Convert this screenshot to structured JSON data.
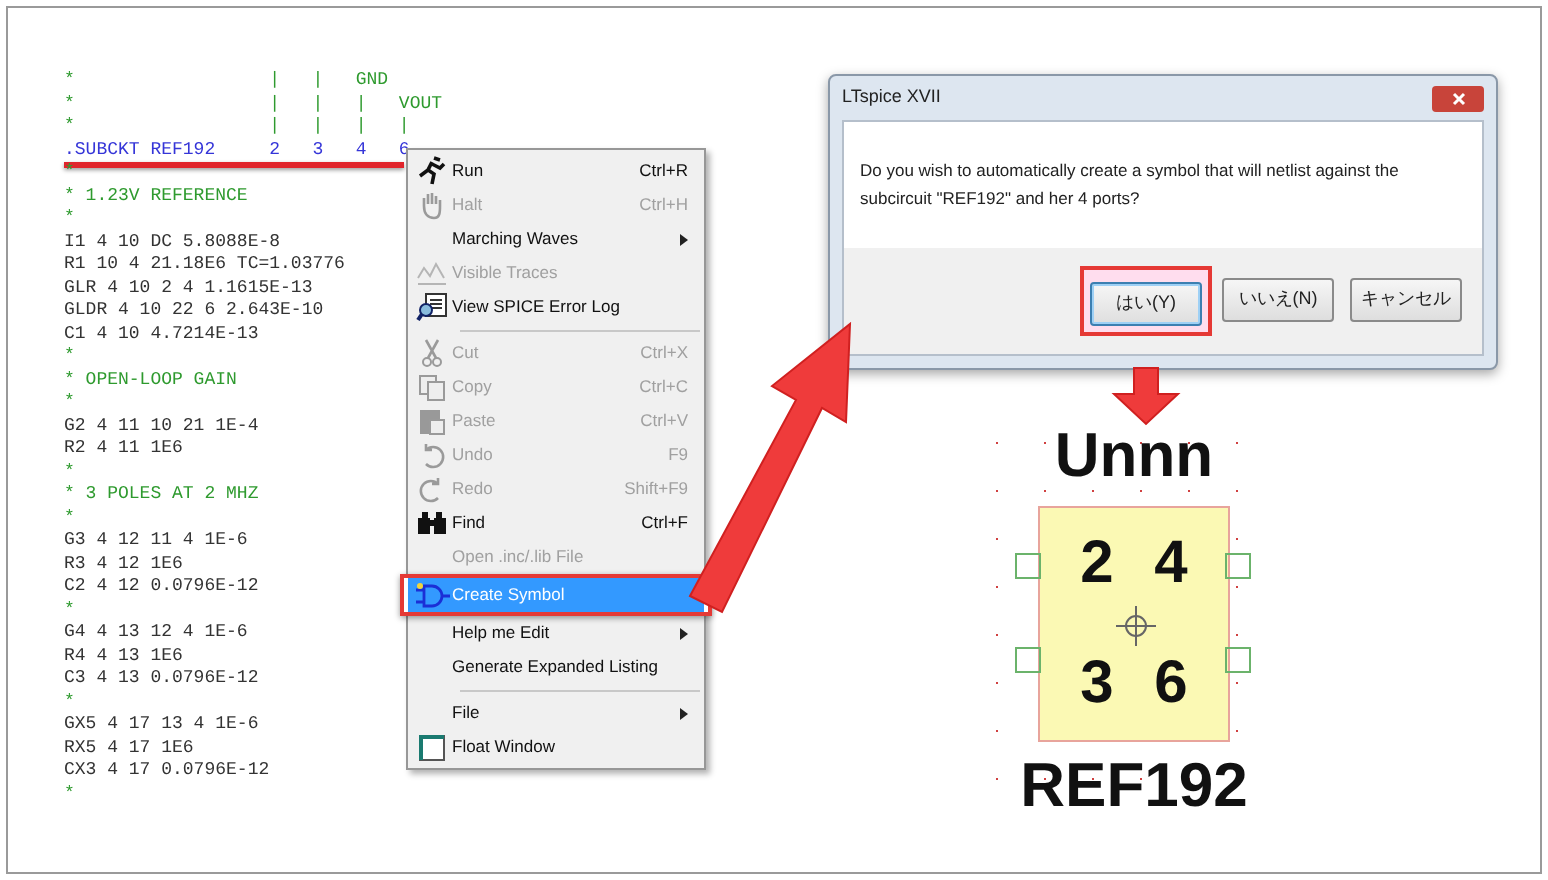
{
  "netlist": {
    "lines": [
      {
        "kind": "comment",
        "text": "*                  |   |   GND"
      },
      {
        "kind": "comment",
        "text": "*                  |   |   |   VOUT"
      },
      {
        "kind": "comment",
        "text": "*                  |   |   |   |"
      },
      {
        "kind": "subckt",
        "text": ".SUBCKT REF192     2   3   4   6"
      },
      {
        "kind": "comment",
        "text": "*"
      },
      {
        "kind": "comment",
        "text": "* 1.23V REFERENCE"
      },
      {
        "kind": "comment",
        "text": "*"
      },
      {
        "kind": "code",
        "text": "I1 4 10 DC 5.8088E-8"
      },
      {
        "kind": "code",
        "text": "R1 10 4 21.18E6 TC=1.03776"
      },
      {
        "kind": "code",
        "text": "GLR 4 10 2 4 1.1615E-13"
      },
      {
        "kind": "code",
        "text": "GLDR 4 10 22 6 2.643E-10"
      },
      {
        "kind": "code",
        "text": "C1 4 10 4.7214E-13"
      },
      {
        "kind": "comment",
        "text": "*"
      },
      {
        "kind": "comment",
        "text": "* OPEN-LOOP GAIN"
      },
      {
        "kind": "comment",
        "text": "*"
      },
      {
        "kind": "code",
        "text": "G2 4 11 10 21 1E-4"
      },
      {
        "kind": "code",
        "text": "R2 4 11 1E6"
      },
      {
        "kind": "comment",
        "text": "*"
      },
      {
        "kind": "comment",
        "text": "* 3 POLES AT 2 MHZ"
      },
      {
        "kind": "comment",
        "text": "*"
      },
      {
        "kind": "code",
        "text": "G3 4 12 11 4 1E-6"
      },
      {
        "kind": "code",
        "text": "R3 4 12 1E6"
      },
      {
        "kind": "code",
        "text": "C2 4 12 0.0796E-12"
      },
      {
        "kind": "comment",
        "text": "*"
      },
      {
        "kind": "code",
        "text": "G4 4 13 12 4 1E-6"
      },
      {
        "kind": "code",
        "text": "R4 4 13 1E6"
      },
      {
        "kind": "code",
        "text": "C3 4 13 0.0796E-12"
      },
      {
        "kind": "comment",
        "text": "*"
      },
      {
        "kind": "code",
        "text": "GX5 4 17 13 4 1E-6"
      },
      {
        "kind": "code",
        "text": "RX5 4 17 1E6"
      },
      {
        "kind": "code",
        "text": "CX3 4 17 0.0796E-12"
      },
      {
        "kind": "comment",
        "text": "*"
      }
    ]
  },
  "context_menu": {
    "items": [
      {
        "kind": "item",
        "label": "Run",
        "shortcut": "Ctrl+R",
        "disabled": false,
        "selected": false,
        "submenu": false,
        "annotated": false
      },
      {
        "kind": "item",
        "label": "Halt",
        "shortcut": "Ctrl+H",
        "disabled": true,
        "selected": false,
        "submenu": false,
        "annotated": false
      },
      {
        "kind": "item",
        "label": "Marching Waves",
        "disabled": false,
        "selected": false,
        "submenu": true,
        "annotated": false
      },
      {
        "kind": "item",
        "label": "Visible Traces",
        "disabled": true,
        "selected": false,
        "submenu": false,
        "annotated": false
      },
      {
        "kind": "item",
        "label": "View SPICE Error Log",
        "disabled": false,
        "selected": false,
        "submenu": false,
        "annotated": false
      },
      {
        "kind": "separator"
      },
      {
        "kind": "item",
        "label": "Cut",
        "shortcut": "Ctrl+X",
        "disabled": true,
        "selected": false,
        "submenu": false,
        "annotated": false
      },
      {
        "kind": "item",
        "label": "Copy",
        "shortcut": "Ctrl+C",
        "disabled": true,
        "selected": false,
        "submenu": false,
        "annotated": false
      },
      {
        "kind": "item",
        "label": "Paste",
        "shortcut": "Ctrl+V",
        "disabled": true,
        "selected": false,
        "submenu": false,
        "annotated": false
      },
      {
        "kind": "item",
        "label": "Undo",
        "shortcut": "F9",
        "disabled": true,
        "selected": false,
        "submenu": false,
        "annotated": false
      },
      {
        "kind": "item",
        "label": "Redo",
        "shortcut": "Shift+F9",
        "disabled": true,
        "selected": false,
        "submenu": false,
        "annotated": false
      },
      {
        "kind": "item",
        "label": "Find",
        "shortcut": "Ctrl+F",
        "disabled": false,
        "selected": false,
        "submenu": false,
        "annotated": false
      },
      {
        "kind": "item",
        "label": "Open .inc/.lib File",
        "disabled": true,
        "selected": false,
        "submenu": false,
        "annotated": false
      },
      {
        "kind": "item",
        "label": "Create Symbol",
        "disabled": false,
        "selected": true,
        "submenu": false,
        "annotated": true
      },
      {
        "kind": "item",
        "label": "Help me Edit",
        "disabled": false,
        "selected": false,
        "submenu": true,
        "annotated": false
      },
      {
        "kind": "item",
        "label": "Generate Expanded Listing",
        "disabled": false,
        "selected": false,
        "submenu": false,
        "annotated": false
      },
      {
        "kind": "separator"
      },
      {
        "kind": "item",
        "label": "File",
        "disabled": false,
        "selected": false,
        "submenu": true,
        "annotated": false
      },
      {
        "kind": "item",
        "label": "Float Window",
        "disabled": false,
        "selected": false,
        "submenu": false,
        "annotated": false
      }
    ]
  },
  "dialog": {
    "title": "LTspice XVII",
    "message": "Do you wish to automatically create a symbol that will netlist against the subcircuit \"REF192\" and her 4 ports?",
    "buttons": [
      {
        "label": "はい(Y)",
        "selected": true,
        "annotated": true
      },
      {
        "label": "いいえ(N)",
        "selected": false,
        "annotated": false
      },
      {
        "label": "キャンセル",
        "selected": false,
        "annotated": false
      }
    ]
  },
  "symbol": {
    "instance": "Unnn",
    "pins": [
      "2",
      "4",
      "3",
      "6"
    ],
    "name": "REF192"
  }
}
